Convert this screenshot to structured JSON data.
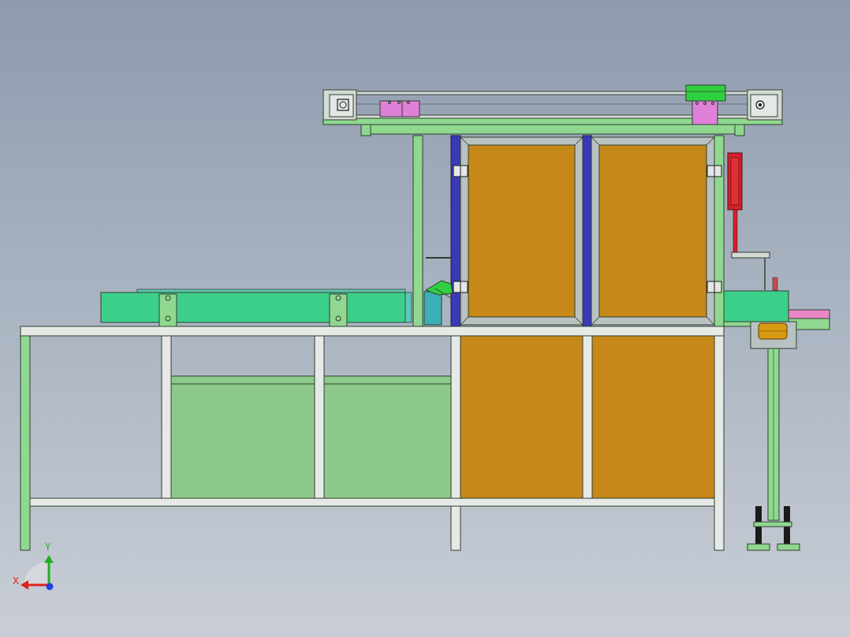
{
  "viewport": {
    "background_top": "#8e9bae",
    "background_bottom": "#c9ced6"
  },
  "model": {
    "frame_color": "#90d890",
    "frame_stroke": "#2f3f2f",
    "panel_color": "#8cc98a",
    "door_color": "#c68818",
    "door_frame_color": "#b9c2c0",
    "conveyor_color": "#3ccf8a",
    "accent_blue": "#3a3ab4",
    "cylinder_red": "#d2202c",
    "pink_block": "#e080d8",
    "roller_gold": "#d89a10"
  },
  "triad": {
    "x_label": "X",
    "y_label": "Y",
    "x_color": "#e02020",
    "y_color": "#20b020",
    "z_color": "#2040e0"
  }
}
